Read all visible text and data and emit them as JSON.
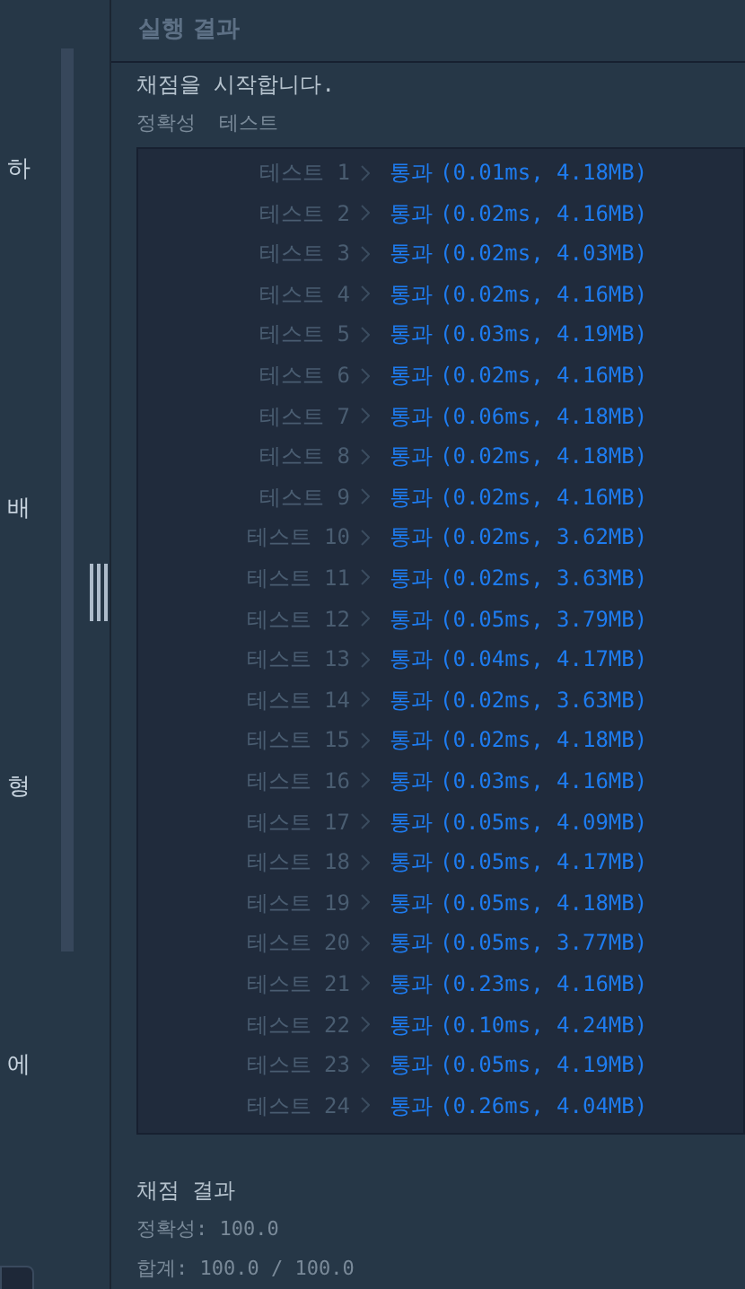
{
  "left_panel": {
    "fragments": [
      "하",
      "배",
      "형",
      "에"
    ]
  },
  "panel": {
    "title": "실행 결과"
  },
  "console": {
    "start_message": "채점을 시작합니다.",
    "section_label": "정확성  테스트",
    "tests": [
      {
        "label": "테스트 1",
        "result": "통과",
        "detail": "(0.01ms, 4.18MB)"
      },
      {
        "label": "테스트 2",
        "result": "통과",
        "detail": "(0.02ms, 4.16MB)"
      },
      {
        "label": "테스트 3",
        "result": "통과",
        "detail": "(0.02ms, 4.03MB)"
      },
      {
        "label": "테스트 4",
        "result": "통과",
        "detail": "(0.02ms, 4.16MB)"
      },
      {
        "label": "테스트 5",
        "result": "통과",
        "detail": "(0.03ms, 4.19MB)"
      },
      {
        "label": "테스트 6",
        "result": "통과",
        "detail": "(0.02ms, 4.16MB)"
      },
      {
        "label": "테스트 7",
        "result": "통과",
        "detail": "(0.06ms, 4.18MB)"
      },
      {
        "label": "테스트 8",
        "result": "통과",
        "detail": "(0.02ms, 4.18MB)"
      },
      {
        "label": "테스트 9",
        "result": "통과",
        "detail": "(0.02ms, 4.16MB)"
      },
      {
        "label": "테스트 10",
        "result": "통과",
        "detail": "(0.02ms, 3.62MB)"
      },
      {
        "label": "테스트 11",
        "result": "통과",
        "detail": "(0.02ms, 3.63MB)"
      },
      {
        "label": "테스트 12",
        "result": "통과",
        "detail": "(0.05ms, 3.79MB)"
      },
      {
        "label": "테스트 13",
        "result": "통과",
        "detail": "(0.04ms, 4.17MB)"
      },
      {
        "label": "테스트 14",
        "result": "통과",
        "detail": "(0.02ms, 3.63MB)"
      },
      {
        "label": "테스트 15",
        "result": "통과",
        "detail": "(0.02ms, 4.18MB)"
      },
      {
        "label": "테스트 16",
        "result": "통과",
        "detail": "(0.03ms, 4.16MB)"
      },
      {
        "label": "테스트 17",
        "result": "통과",
        "detail": "(0.05ms, 4.09MB)"
      },
      {
        "label": "테스트 18",
        "result": "통과",
        "detail": "(0.05ms, 4.17MB)"
      },
      {
        "label": "테스트 19",
        "result": "통과",
        "detail": "(0.05ms, 4.18MB)"
      },
      {
        "label": "테스트 20",
        "result": "통과",
        "detail": "(0.05ms, 3.77MB)"
      },
      {
        "label": "테스트 21",
        "result": "통과",
        "detail": "(0.23ms, 4.16MB)"
      },
      {
        "label": "테스트 22",
        "result": "통과",
        "detail": "(0.10ms, 4.24MB)"
      },
      {
        "label": "테스트 23",
        "result": "통과",
        "detail": "(0.05ms, 4.19MB)"
      },
      {
        "label": "테스트 24",
        "result": "통과",
        "detail": "(0.26ms, 4.04MB)"
      }
    ],
    "summary_title": "채점 결과",
    "accuracy": "정확성: 100.0",
    "total": "합계: 100.0 / 100.0"
  }
}
